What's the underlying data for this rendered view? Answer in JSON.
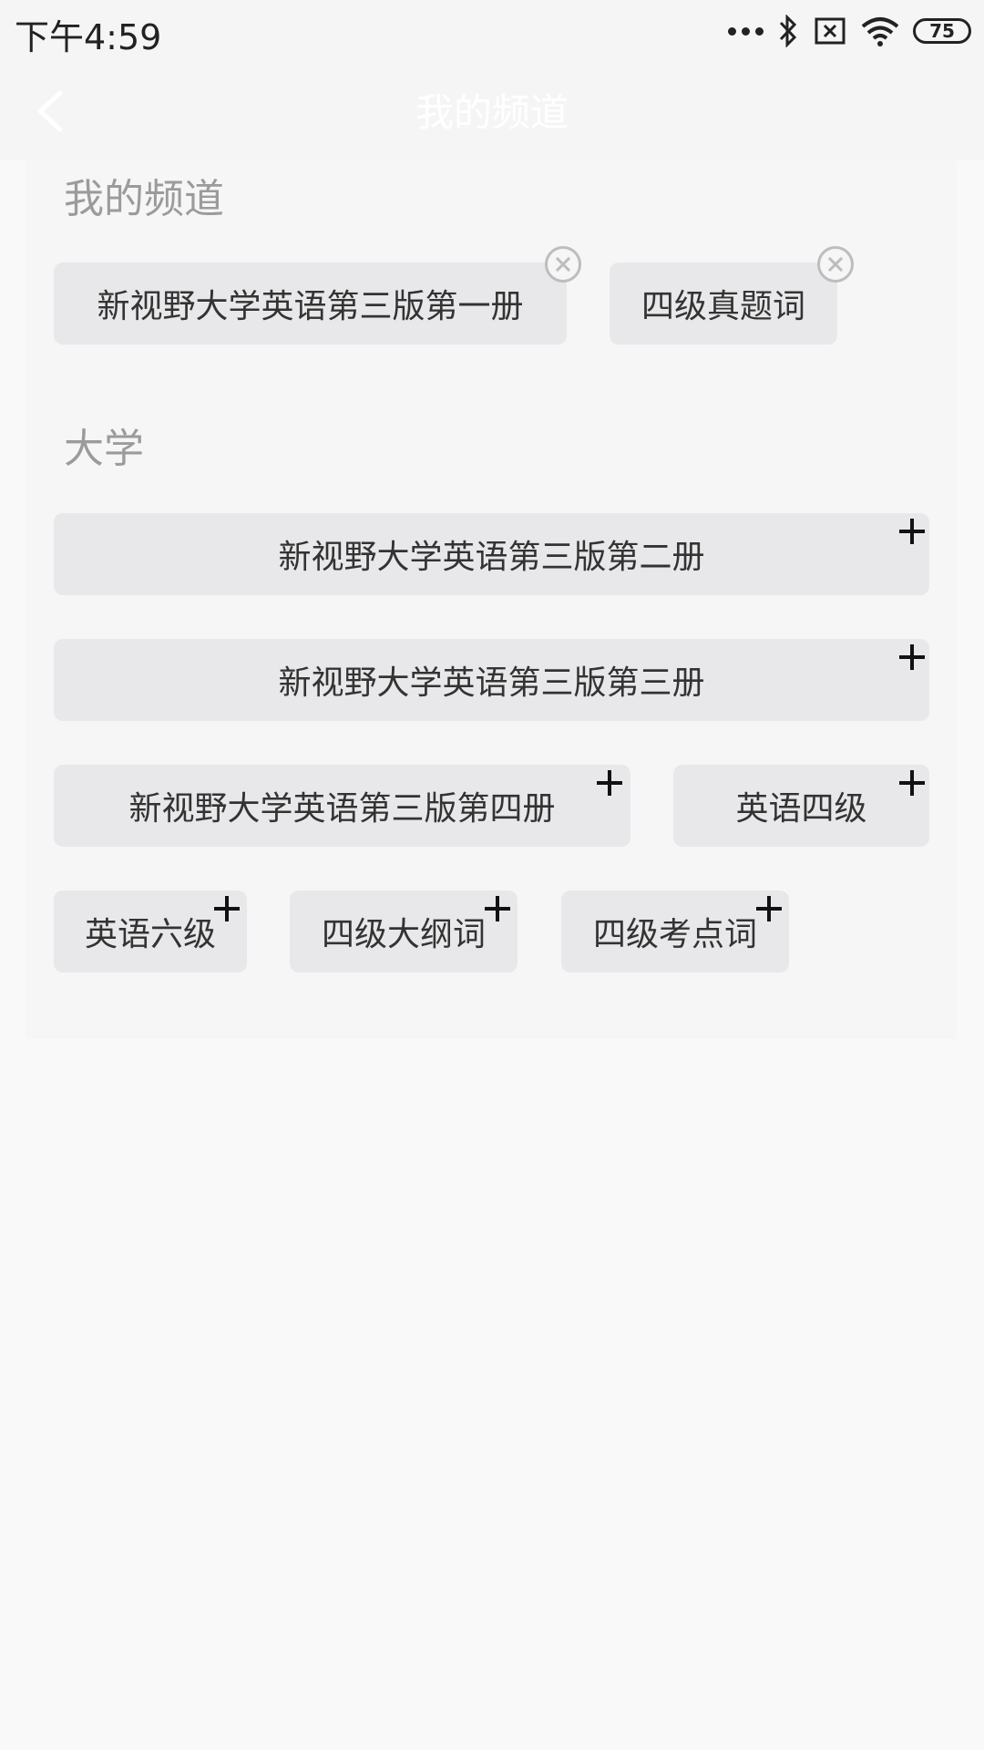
{
  "status_bar": {
    "time": "下午4:59",
    "battery": "75",
    "icons": [
      "dots-icon",
      "bluetooth-icon",
      "sim-x-icon",
      "wifi-icon",
      "battery-icon"
    ]
  },
  "nav": {
    "title": "我的频道",
    "back_icon": "chevron-left-icon"
  },
  "my_channels": {
    "title": "我的频道",
    "items": [
      {
        "label": "新视野大学英语第三版第一册"
      },
      {
        "label": "四级真题词"
      }
    ]
  },
  "university": {
    "title": "大学",
    "items": [
      {
        "label": "新视野大学英语第三版第二册"
      },
      {
        "label": "新视野大学英语第三版第三册"
      },
      {
        "label": "新视野大学英语第三版第四册"
      },
      {
        "label": "英语四级"
      },
      {
        "label": "英语六级"
      },
      {
        "label": "四级大纲词"
      },
      {
        "label": "四级考点词"
      }
    ]
  },
  "colors": {
    "chip_bg": "#e8e8ea",
    "section_title": "#9b9b9b",
    "nav_title": "#ffffff"
  }
}
